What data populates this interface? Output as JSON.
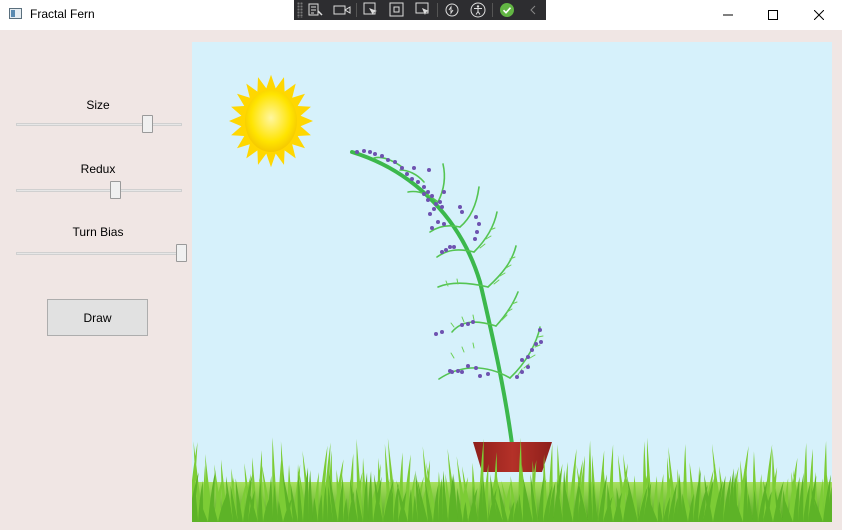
{
  "window": {
    "title": "Fractal Fern"
  },
  "controls": {
    "size": {
      "label": "Size",
      "value": 0.79
    },
    "redux": {
      "label": "Redux",
      "value": 0.59
    },
    "turn_bias": {
      "label": "Turn Bias",
      "value": 1.0
    },
    "draw_label": "Draw"
  },
  "icons": {
    "app": "window-app-icon",
    "minimize": "minimize-icon",
    "maximize": "maximize-icon",
    "close": "close-icon",
    "debug_toolbar": [
      "live-visual-tree-icon",
      "record-icon",
      "select-element-icon",
      "display-adorners-icon",
      "track-focus-icon",
      "hot-reload-icon",
      "accessibility-icon",
      "check-icon",
      "collapse-chevron-icon"
    ]
  },
  "colors": {
    "sky": "#d6f1fb",
    "stem": "#3cb84c",
    "pot": "#a52a25",
    "berry": "#6e52b0",
    "sun": "#ffe100",
    "grass": "#7ccc35"
  }
}
